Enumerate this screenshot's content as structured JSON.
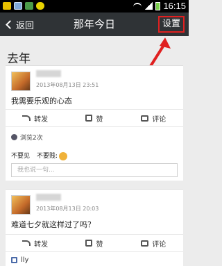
{
  "header": {
    "back_label": "返回",
    "title": "那年今日",
    "settings_label": "设置"
  },
  "status_bar": {
    "time": "16:15"
  },
  "section": {
    "title": "去年"
  },
  "posts": [
    {
      "time": "2013年08月13日 23:51",
      "text": "我需要乐观的心态",
      "actions": {
        "share": "转发",
        "like": "赞",
        "comment": "评论"
      },
      "views": "浏览2次",
      "reactions": [
        "不要见",
        "不要贱:"
      ],
      "comment_placeholder": "我也说一句..."
    },
    {
      "time": "2013年08月13日 20:03",
      "text": "难道七夕就这样过了吗？",
      "actions": {
        "share": "转发",
        "like": "赞",
        "comment": "评论"
      },
      "likes": "lly"
    }
  ]
}
